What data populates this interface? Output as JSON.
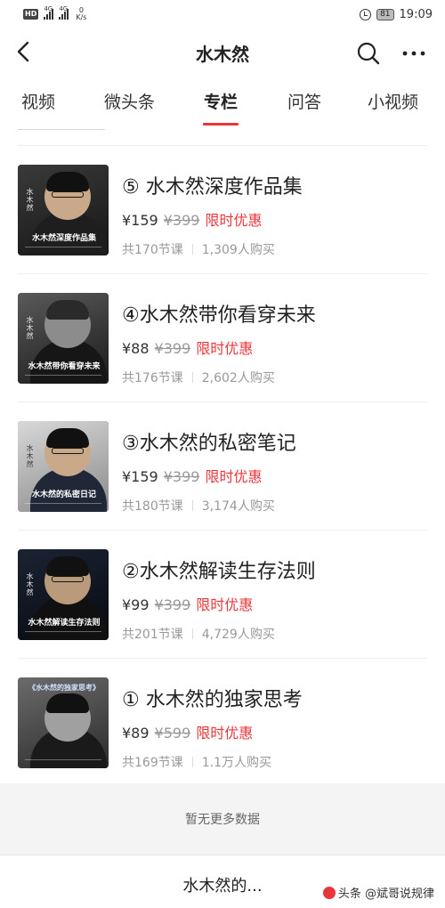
{
  "status_bar": {
    "network": "HD",
    "sig1": "4G",
    "sig2": "4G",
    "net_speed": "0",
    "net_speed_unit": "K/s",
    "battery": "81",
    "time": "19:09"
  },
  "nav": {
    "title": "水木然",
    "icons": [
      "back-icon",
      "search-icon",
      "more-icon"
    ]
  },
  "tabs": [
    {
      "label": "视频"
    },
    {
      "label": "微头条"
    },
    {
      "label": "专栏"
    },
    {
      "label": "问答"
    },
    {
      "label": "小视频"
    }
  ],
  "active_tab_index": 2,
  "courses": [
    {
      "title": "⑤ 水木然深度作品集",
      "price": "¥159",
      "original_price": "¥399",
      "promo": "限时优惠",
      "lessons": "共170节课",
      "buyers": "1,309人购买",
      "cover_name": "水木然",
      "cover_title": "水木然深度作品集"
    },
    {
      "title": "④水木然带你看穿未来",
      "price": "¥88",
      "original_price": "¥399",
      "promo": "限时优惠",
      "lessons": "共176节课",
      "buyers": "2,602人购买",
      "cover_name": "水木然",
      "cover_title": "水木然带你看穿未来"
    },
    {
      "title": "③水木然的私密笔记",
      "price": "¥159",
      "original_price": "¥399",
      "promo": "限时优惠",
      "lessons": "共180节课",
      "buyers": "3,174人购买",
      "cover_name": "水木然",
      "cover_title": "水木然的私密日记"
    },
    {
      "title": "②水木然解读生存法则",
      "price": "¥99",
      "original_price": "¥399",
      "promo": "限时优惠",
      "lessons": "共201节课",
      "buyers": "4,729人购买",
      "cover_name": "水木然",
      "cover_title": "水木然解读生存法则"
    },
    {
      "title": "① 水木然的独家思考",
      "price": "¥89",
      "original_price": "¥599",
      "promo": "限时优惠",
      "lessons": "共169节课",
      "buyers": "1.1万人购买",
      "cover_name": "",
      "cover_title": "《水木然的独家思考》"
    }
  ],
  "footer": {
    "no_more": "暂无更多数据",
    "bottom_label": "水木然的...",
    "watermark": "头条 @斌哥说规律"
  },
  "colors": {
    "accent": "#e8373c",
    "muted": "#999999"
  }
}
